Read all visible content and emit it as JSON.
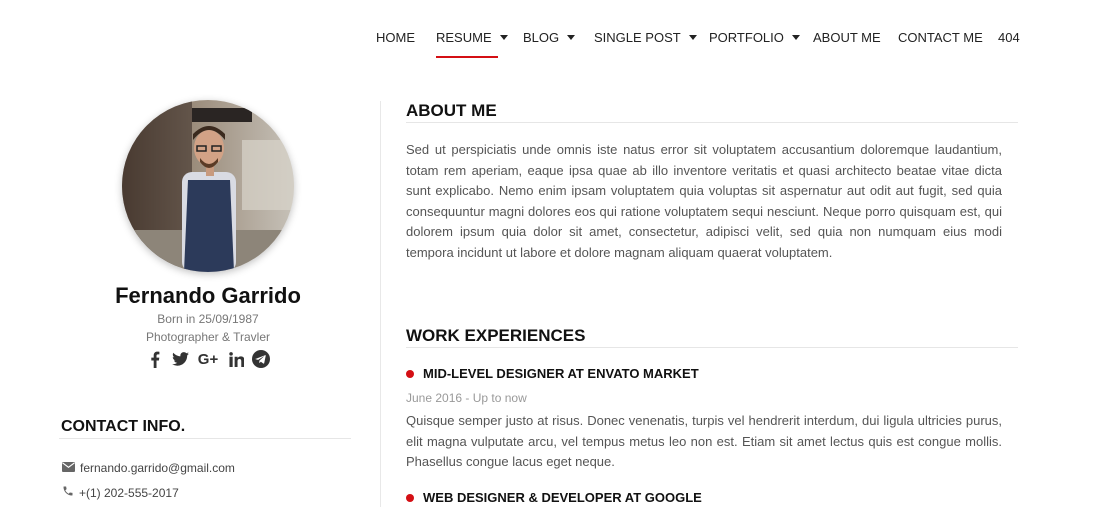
{
  "nav": {
    "items": [
      {
        "label": "HOME",
        "dropdown": false
      },
      {
        "label": "RESUME",
        "dropdown": true
      },
      {
        "label": "BLOG",
        "dropdown": true
      },
      {
        "label": "SINGLE POST",
        "dropdown": true
      },
      {
        "label": "PORTFOLIO",
        "dropdown": true
      },
      {
        "label": "ABOUT ME",
        "dropdown": false
      },
      {
        "label": "CONTACT ME",
        "dropdown": false
      },
      {
        "label": "404",
        "dropdown": false
      }
    ],
    "active": "RESUME",
    "accent_color": "#d40f14"
  },
  "profile": {
    "name": "Fernando Garrido",
    "born": "Born in 25/09/1987",
    "role": "Photographer & Travler",
    "socials": [
      "facebook-icon",
      "twitter-icon",
      "google-plus-icon",
      "linkedin-icon",
      "telegram-icon"
    ]
  },
  "contact": {
    "title": "CONTACT INFO.",
    "email": "fernando.garrido@gmail.com",
    "phone": "+(1) 202-555-2017"
  },
  "about": {
    "title": "ABOUT ME",
    "text": "Sed ut perspiciatis unde omnis iste natus error sit voluptatem accusantium doloremque laudantium, totam rem aperiam, eaque ipsa quae ab illo inventore veritatis et quasi architecto beatae vitae dicta sunt explicabo. Nemo enim ipsam voluptatem quia voluptas sit aspernatur aut odit aut fugit, sed quia consequuntur magni dolores eos qui ratione voluptatem sequi nesciunt. Neque porro quisquam est, qui dolorem ipsum quia dolor sit amet, consectetur, adipisci velit, sed quia non numquam eius modi tempora incidunt ut labore et dolore magnam aliquam quaerat voluptatem."
  },
  "work": {
    "title": "WORK EXPERIENCES",
    "jobs": [
      {
        "title": "MID-LEVEL DESIGNER AT ENVATO MARKET",
        "date": "June 2016 - Up to now",
        "text": "Quisque semper justo at risus. Donec venenatis, turpis vel hendrerit interdum, dui ligula ultricies purus, elit magna vulputate arcu, vel tempus metus leo non est. Etiam sit amet lectus quis est congue mollis. Phasellus congue lacus eget neque."
      },
      {
        "title": "WEB DESIGNER & DEVELOPER AT GOOGLE"
      }
    ]
  }
}
